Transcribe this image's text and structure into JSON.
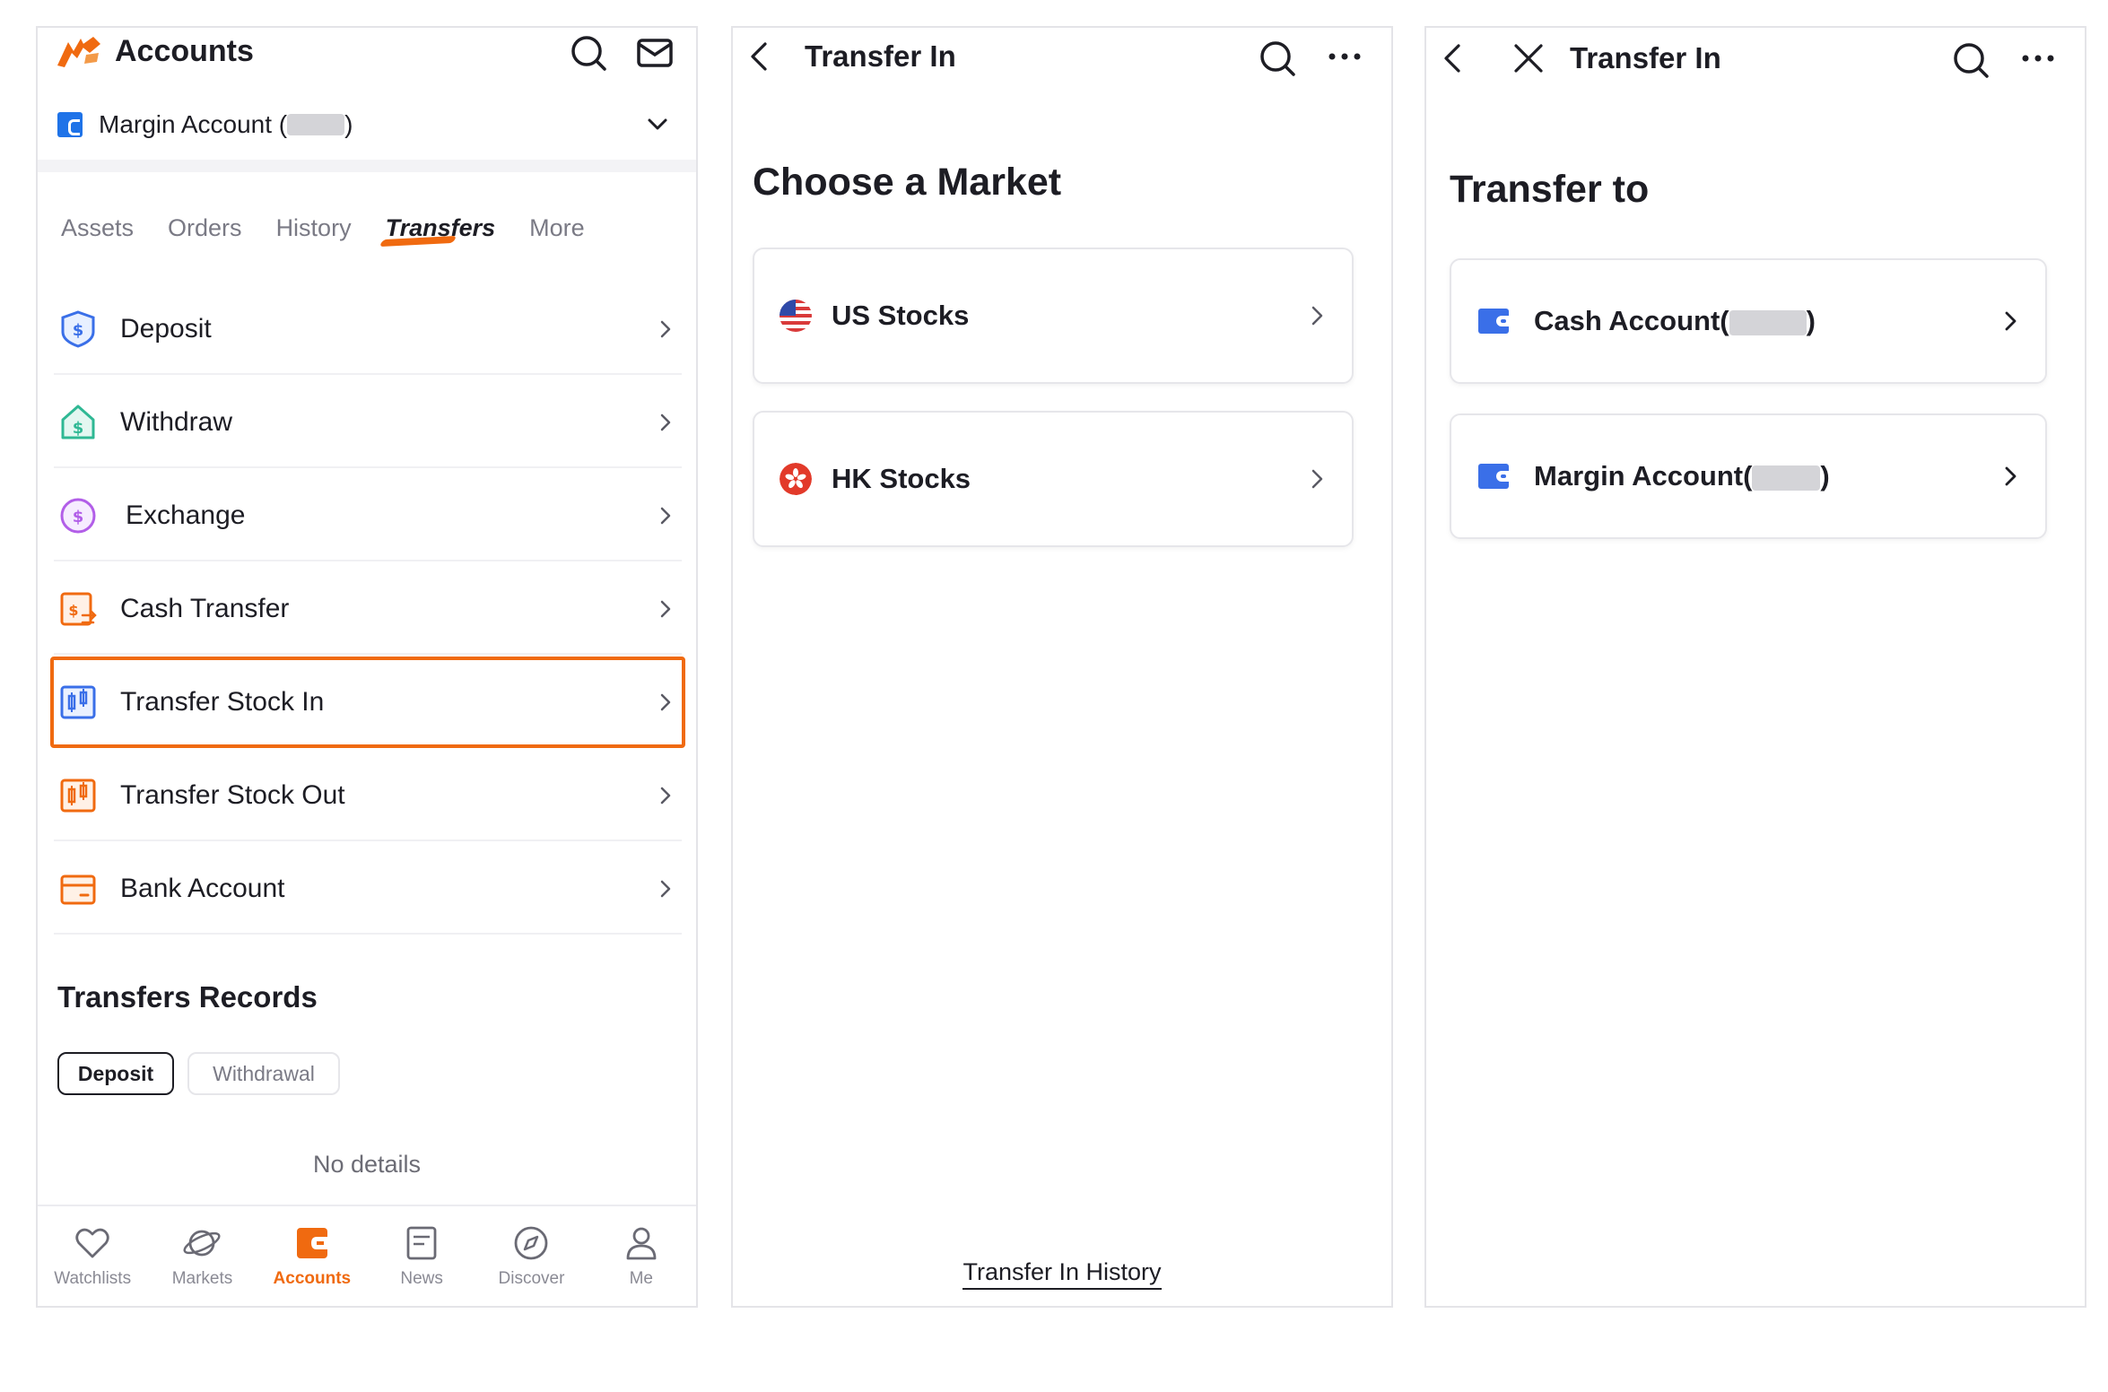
{
  "panel1": {
    "header": {
      "title": "Accounts"
    },
    "account_selector": {
      "label_prefix": "Margin Account (",
      "label_suffix": ")"
    },
    "tabs": [
      {
        "label": "Assets"
      },
      {
        "label": "Orders"
      },
      {
        "label": "History"
      },
      {
        "label": "Transfers",
        "active": true
      },
      {
        "label": "More"
      }
    ],
    "menu": [
      {
        "label": "Deposit",
        "icon": "deposit-icon"
      },
      {
        "label": "Withdraw",
        "icon": "withdraw-icon"
      },
      {
        "label": "Exchange",
        "icon": "exchange-icon"
      },
      {
        "label": "Cash Transfer",
        "icon": "cash-transfer-icon"
      },
      {
        "label": "Transfer Stock In",
        "icon": "transfer-stock-in-icon",
        "highlighted": true
      },
      {
        "label": "Transfer Stock Out",
        "icon": "transfer-stock-out-icon"
      },
      {
        "label": "Bank Account",
        "icon": "bank-account-icon"
      }
    ],
    "records": {
      "title": "Transfers Records",
      "filters": [
        {
          "label": "Deposit",
          "active": true
        },
        {
          "label": "Withdrawal"
        }
      ],
      "empty_text": "No details"
    },
    "bottom_nav": [
      {
        "label": "Watchlists",
        "icon": "heart-icon"
      },
      {
        "label": "Markets",
        "icon": "planet-icon"
      },
      {
        "label": "Accounts",
        "icon": "wallet-icon",
        "active": true
      },
      {
        "label": "News",
        "icon": "news-icon"
      },
      {
        "label": "Discover",
        "icon": "compass-icon"
      },
      {
        "label": "Me",
        "icon": "person-icon"
      }
    ]
  },
  "panel2": {
    "header": {
      "title": "Transfer In"
    },
    "heading": "Choose a Market",
    "markets": [
      {
        "label": "US Stocks",
        "icon": "us-flag-icon"
      },
      {
        "label": "HK Stocks",
        "icon": "hk-flag-icon"
      }
    ],
    "history_link": "Transfer In History"
  },
  "panel3": {
    "header": {
      "title": "Transfer In"
    },
    "heading": "Transfer to",
    "accounts": [
      {
        "label_prefix": "Cash Account(",
        "label_suffix": ")"
      },
      {
        "label_prefix": "Margin Account(",
        "label_suffix": ")"
      }
    ]
  },
  "colors": {
    "accent": "#f06a10",
    "text": "#1d1d24",
    "muted": "#7a7a85",
    "account_blue": "#1f73e8",
    "wallet_blue": "#3a6fe8",
    "border": "#e4e4e8"
  }
}
